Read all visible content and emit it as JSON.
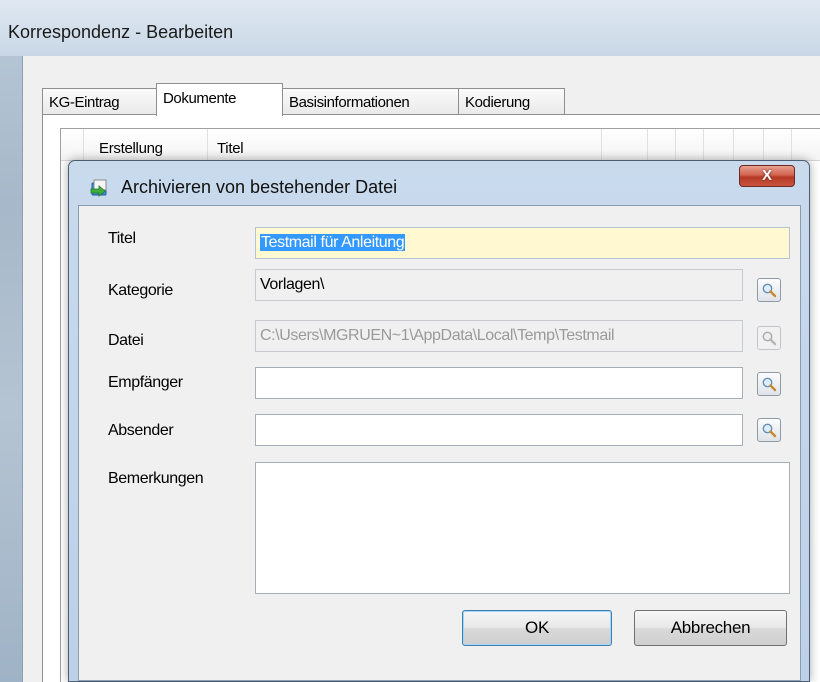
{
  "window": {
    "title": "Korrespondenz - Bearbeiten"
  },
  "tabs": [
    {
      "label": "KG-Eintrag",
      "active": false
    },
    {
      "label": "Dokumente",
      "active": true
    },
    {
      "label": "Basisinformationen",
      "active": false
    },
    {
      "label": "Kodierung",
      "active": false
    }
  ],
  "grid": {
    "columns": [
      "Erstellung",
      "Titel"
    ]
  },
  "dialog": {
    "title": "Archivieren von bestehender Datei",
    "icon": "archive-document-icon",
    "close_label": "X",
    "fields": {
      "titel": {
        "label": "Titel",
        "value": "Testmail für Anleitung"
      },
      "kategorie": {
        "label": "Kategorie",
        "value": "Vorlagen\\"
      },
      "datei": {
        "label": "Datei",
        "value": "C:\\Users\\MGRUEN~1\\AppData\\Local\\Temp\\Testmail"
      },
      "empfaenger": {
        "label": "Empfänger",
        "value": ""
      },
      "absender": {
        "label": "Absender",
        "value": ""
      },
      "bemerkungen": {
        "label": "Bemerkungen",
        "value": ""
      }
    },
    "buttons": {
      "ok": "OK",
      "cancel": "Abbrechen"
    }
  },
  "colors": {
    "selection": "#3399ff",
    "highlight_field": "#fff8d0",
    "close_button": "#c9553e"
  }
}
